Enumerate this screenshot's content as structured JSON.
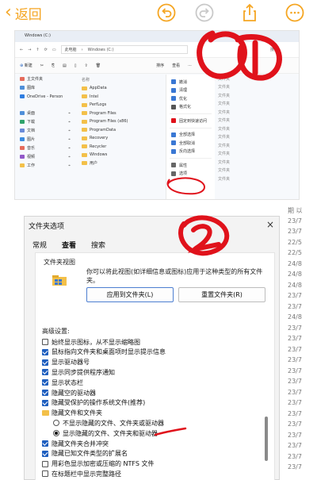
{
  "editor": {
    "back_label": "返回",
    "accent": "#f5a623"
  },
  "explorer": {
    "tab_title": "Windows (C:)",
    "address": [
      "此电脑",
      "Windows (C:)"
    ],
    "search_placeholder": "搜索",
    "new_label": "新建",
    "sort_label": "排序",
    "view_label": "查看",
    "files_header": "名称",
    "nav_items": [
      {
        "label": "主文件夹",
        "color": "#e56b5b"
      },
      {
        "label": "图库",
        "color": "#4f8fd9"
      },
      {
        "label": "OneDrive - Person",
        "color": "#2f7de1"
      },
      {
        "label": "桌面",
        "color": "#4f8fd9"
      },
      {
        "label": "下载",
        "color": "#2fa36b"
      },
      {
        "label": "文档",
        "color": "#6a8bd8"
      },
      {
        "label": "图片",
        "color": "#3b8be0"
      },
      {
        "label": "音乐",
        "color": "#e56b5b"
      },
      {
        "label": "视频",
        "color": "#9257c9"
      },
      {
        "label": "工作",
        "color": "#f3c049"
      }
    ],
    "files": [
      "AppData",
      "Intel",
      "PerfLogs",
      "Program Files",
      "Program Files (x86)",
      "ProgramData",
      "Recovery",
      "Recycler",
      "Windows",
      "用户"
    ],
    "menu_items": [
      "撤消",
      "清理",
      "优化",
      "格式化",
      "固定到快速访问",
      "全部选择",
      "全部取消",
      "反向选择",
      "属性",
      "选项"
    ],
    "types": [
      "文件夹",
      "文件夹",
      "文件夹",
      "文件夹",
      "文件夹",
      "文件夹",
      "文件夹",
      "文件夹",
      "文件夹",
      "文件夹",
      "文件夹",
      "文件夹",
      "文件夹"
    ]
  },
  "dialog": {
    "title": "文件夹选项",
    "close": "×",
    "tabs": [
      "常规",
      "查看",
      "搜索"
    ],
    "active_tab": "查看",
    "folder_view_title": "文件夹视图",
    "folder_view_desc": "你可以将此视图(如详细信息或图标)应用于这种类型的所有文件夹。",
    "apply_button": "应用到文件夹(L)",
    "reset_button": "重置文件夹(R)",
    "advanced_label": "高级设置:",
    "rows": [
      {
        "kind": "checkbox",
        "checked": false,
        "indent": 0,
        "label": "始终显示图标，从不显示缩略图"
      },
      {
        "kind": "checkbox",
        "checked": true,
        "indent": 0,
        "label": "鼠标指向文件夹和桌面项时显示提示信息"
      },
      {
        "kind": "checkbox",
        "checked": true,
        "indent": 0,
        "label": "显示驱动器号"
      },
      {
        "kind": "checkbox",
        "checked": true,
        "indent": 0,
        "label": "显示同步提供程序通知"
      },
      {
        "kind": "checkbox",
        "checked": true,
        "indent": 0,
        "label": "显示状态栏"
      },
      {
        "kind": "checkbox",
        "checked": true,
        "indent": 0,
        "label": "隐藏空的驱动器"
      },
      {
        "kind": "checkbox",
        "checked": true,
        "indent": 0,
        "label": "隐藏受保护的操作系统文件(推荐)"
      },
      {
        "kind": "folder",
        "indent": 0,
        "label": "隐藏文件和文件夹"
      },
      {
        "kind": "radio",
        "checked": false,
        "indent": 1,
        "label": "不显示隐藏的文件、文件夹或驱动器"
      },
      {
        "kind": "radio",
        "checked": true,
        "indent": 1,
        "label": "显示隐藏的文件、文件夹和驱动器"
      },
      {
        "kind": "checkbox",
        "checked": true,
        "indent": 0,
        "label": "隐藏文件夹合并冲突"
      },
      {
        "kind": "checkbox",
        "checked": true,
        "indent": 0,
        "label": "隐藏已知文件类型的扩展名"
      },
      {
        "kind": "checkbox",
        "checked": false,
        "indent": 0,
        "label": "用彩色显示加密或压缩的 NTFS 文件"
      },
      {
        "kind": "checkbox",
        "checked": false,
        "indent": 0,
        "label": "在标题栏中显示完整路径"
      }
    ]
  },
  "right_strip": [
    "期 以",
    "23/7",
    "23/7",
    "22/5",
    "22/5",
    "24/8",
    "24/8",
    "24/8",
    "23/7",
    "23/7",
    "24/8",
    "23/7",
    "23/7",
    "23/7",
    "23/7",
    "23/7",
    "23/7",
    "23/7",
    "23/7",
    "23/7",
    "23/7",
    "23/7",
    "23/7",
    "23/7",
    "23/7"
  ],
  "annotation_color": "#e0121b"
}
